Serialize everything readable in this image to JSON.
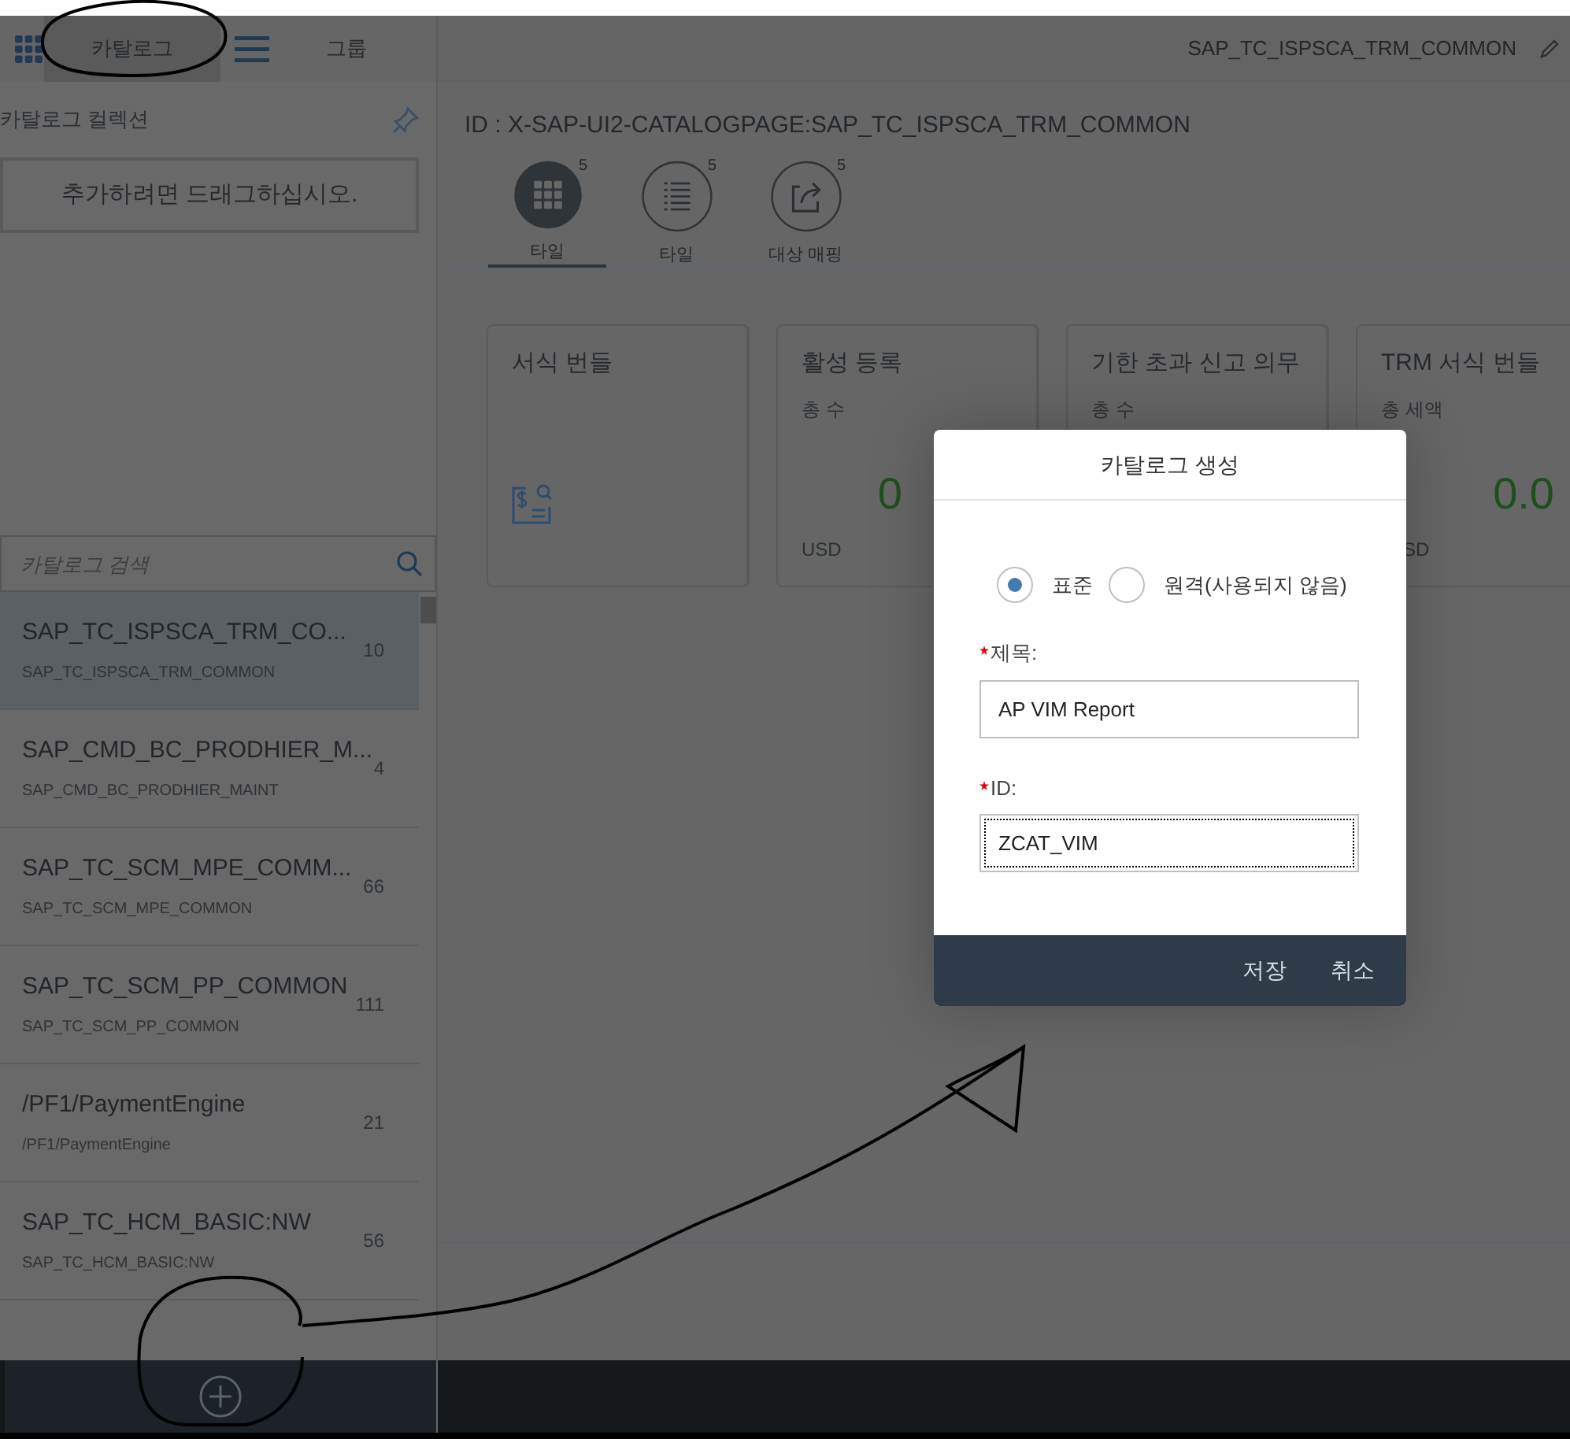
{
  "shell": {
    "tabs": [
      {
        "label": "카탈로그",
        "selected": true
      },
      {
        "label": "그룹",
        "selected": false
      }
    ],
    "title": "SAP_TC_ISPSCA_TRM_COMMON"
  },
  "sidebar": {
    "heading": "카탈로그 컬렉션",
    "drop_zone": "추가하려면 드래그하십시오.",
    "search": {
      "placeholder": "카탈로그 검색"
    },
    "items": [
      {
        "title": "SAP_TC_ISPSCA_TRM_CO...",
        "subtitle": "SAP_TC_ISPSCA_TRM_COMMON",
        "count": "10",
        "selected": true
      },
      {
        "title": "SAP_CMD_BC_PRODHIER_M...",
        "subtitle": "SAP_CMD_BC_PRODHIER_MAINT",
        "count": "4",
        "selected": false
      },
      {
        "title": "SAP_TC_SCM_MPE_COMM...",
        "subtitle": "SAP_TC_SCM_MPE_COMMON",
        "count": "66",
        "selected": false
      },
      {
        "title": "SAP_TC_SCM_PP_COMMON",
        "subtitle": "SAP_TC_SCM_PP_COMMON",
        "count": "111",
        "selected": false
      },
      {
        "title": "/PF1/PaymentEngine",
        "subtitle": "/PF1/PaymentEngine",
        "count": "21",
        "selected": false
      },
      {
        "title": "SAP_TC_HCM_BASIC:NW",
        "subtitle": "SAP_TC_HCM_BASIC:NW",
        "count": "56",
        "selected": false
      }
    ]
  },
  "content": {
    "id_line": "ID : X-SAP-UI2-CATALOGPAGE:SAP_TC_ISPSCA_TRM_COMMON",
    "tabs": [
      {
        "label": "타일",
        "count": "5",
        "selected": true,
        "kind": "grid"
      },
      {
        "label": "타일",
        "count": "5",
        "selected": false,
        "kind": "list"
      },
      {
        "label": "대상 매핑",
        "count": "5",
        "selected": false,
        "kind": "share"
      }
    ],
    "tiles": [
      {
        "title": "서식 번들",
        "kind": "icon"
      },
      {
        "title": "활성 등록",
        "subtitle": "총 수",
        "value": "0",
        "unit": "USD",
        "kind": "kpi"
      },
      {
        "title": "기한 초과 신고 의무",
        "subtitle": "총 수",
        "kind": "kpi"
      },
      {
        "title": "TRM 서식 번들",
        "subtitle": "총 세액",
        "value": "0.0",
        "unit": "SD",
        "kind": "kpi"
      }
    ]
  },
  "dialog": {
    "title": "카탈로그 생성",
    "options": [
      {
        "label": "표준",
        "selected": true
      },
      {
        "label": "원격(사용되지 않음)",
        "selected": false
      }
    ],
    "fields": [
      {
        "label": "제목:",
        "required": true,
        "value": "AP VIM Report",
        "focused": false
      },
      {
        "label": "ID:",
        "required": true,
        "value": "ZCAT_VIM",
        "focused": true
      }
    ],
    "buttons": [
      "저장",
      "취소"
    ]
  }
}
